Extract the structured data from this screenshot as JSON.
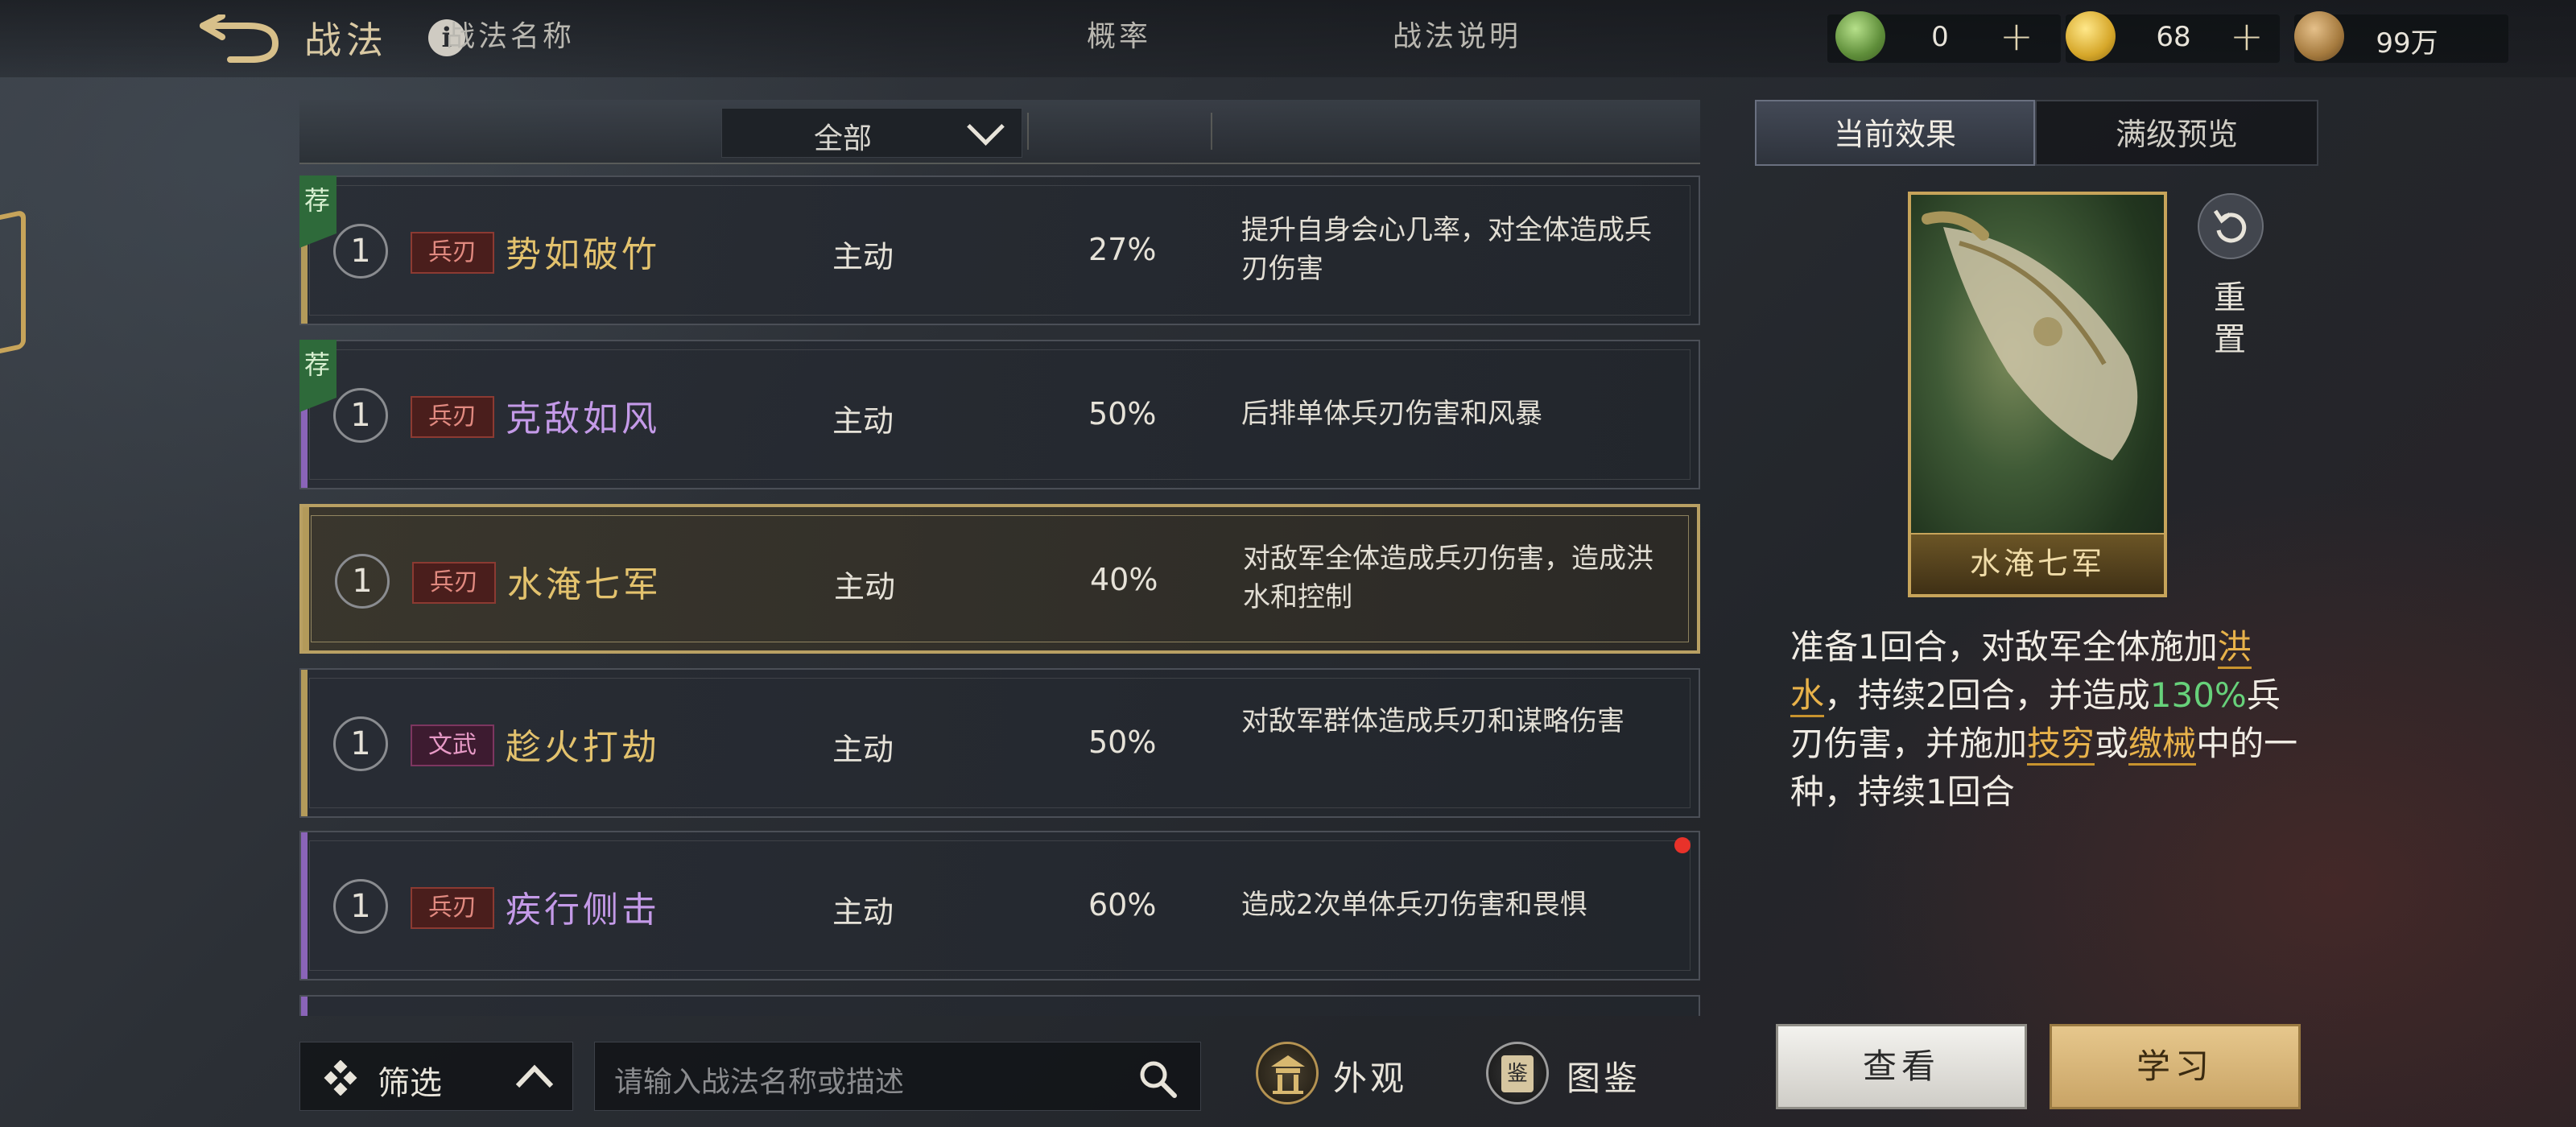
{
  "header": {
    "title": "战法",
    "info_glyph": "i",
    "currencies": [
      {
        "icon": "jade-coin-icon",
        "value": "0",
        "plus": "+"
      },
      {
        "icon": "gold-coin-icon",
        "value": "68",
        "plus": "+"
      },
      {
        "icon": "copper-coin-icon",
        "value": "99万"
      }
    ]
  },
  "table": {
    "headers": {
      "name": "战法名称",
      "filter": "全部",
      "rate": "概率",
      "desc": "战法说明"
    },
    "rows": [
      {
        "recommended": "荐",
        "level": "1",
        "tag": "兵刃",
        "name": "势如破竹",
        "type": "主动",
        "rate": "27%",
        "desc": "提升自身会心几率，对全体造成兵刃伤害"
      },
      {
        "recommended": "荐",
        "level": "1",
        "tag": "兵刃",
        "name": "克敌如风",
        "type": "主动",
        "rate": "50%",
        "desc": "后排单体兵刃伤害和风暴"
      },
      {
        "level": "1",
        "tag": "兵刃",
        "name": "水淹七军",
        "type": "主动",
        "rate": "40%",
        "desc": "对敌军全体造成兵刃伤害，造成洪水和控制"
      },
      {
        "level": "1",
        "tag": "文武",
        "name": "趁火打劫",
        "type": "主动",
        "rate": "50%",
        "desc": "对敌军群体造成兵刃和谋略伤害"
      },
      {
        "level": "1",
        "tag": "兵刃",
        "name": "疾行侧击",
        "type": "主动",
        "rate": "60%",
        "desc": "造成2次单体兵刃伤害和畏惧"
      }
    ]
  },
  "toolbar": {
    "filter_label": "筛选",
    "search_placeholder": "请输入战法名称或描述",
    "appearance_label": "外观",
    "atlas_label": "图鉴",
    "atlas_glyph": "鉴"
  },
  "panel": {
    "tabs": [
      "当前效果",
      "满级预览"
    ],
    "card_name": "水淹七军",
    "reset_label": "重置",
    "effect": {
      "p1": "准备1回合，对敌军全体施加",
      "kw1": "洪水",
      "p2": "，持续2回合，并造成",
      "pct": "130%",
      "p3": "兵刃伤害，并施加",
      "kw2": "技穷",
      "p4": "或",
      "kw3": "缴械",
      "p5": "中的一种，持续1回合"
    },
    "view_label": "查看",
    "learn_label": "学习"
  },
  "colors": {
    "gold_name": "#e3c26d",
    "purple_name": "#c49ae8",
    "keyword": "#e8b24a",
    "percent": "#67d17a",
    "selected_border": "#b9a063"
  }
}
